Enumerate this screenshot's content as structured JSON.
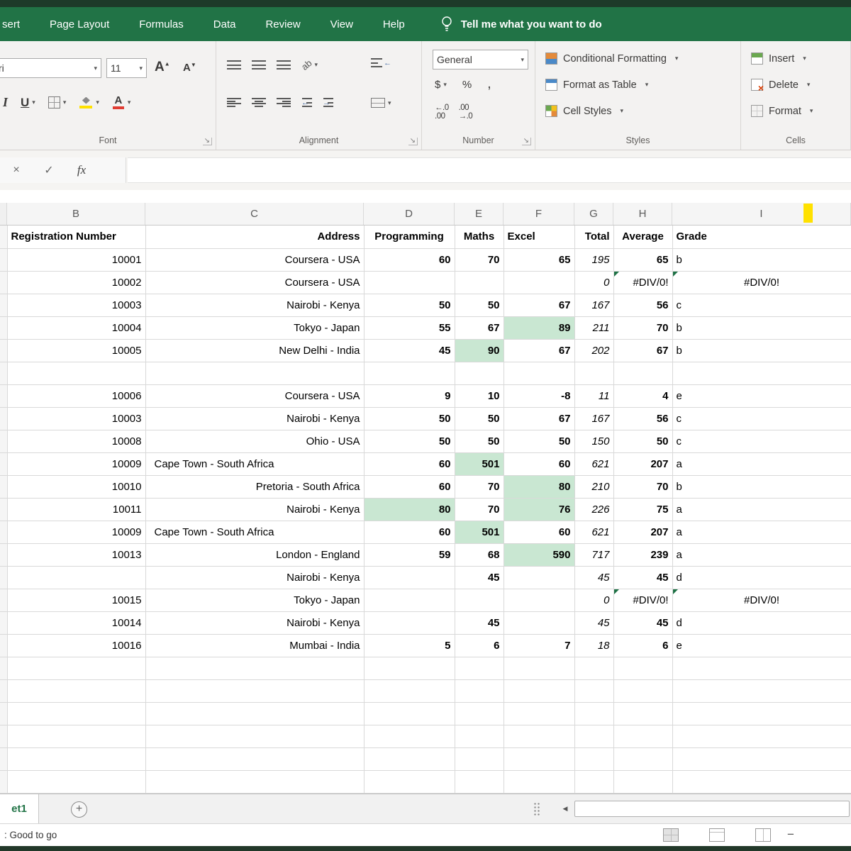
{
  "colors": {
    "excel_green": "#217346",
    "highlight_green": "#c9e7d2",
    "error_indicator_green": "#1e7145",
    "fill_color_yellow": "#ffe100",
    "font_color_red": "#e03c32",
    "delete_x_orange": "#d83b01"
  },
  "ribbon": {
    "tabs": [
      "sert",
      "Page Layout",
      "Formulas",
      "Data",
      "Review",
      "View",
      "Help"
    ],
    "tell_me": "Tell me what you want to do",
    "groups": {
      "font": {
        "label": "Font",
        "font_name": "ri",
        "font_size": "11"
      },
      "alignment": {
        "label": "Alignment"
      },
      "number": {
        "label": "Number",
        "format": "General",
        "currency": "$",
        "percent": "%",
        "comma": ","
      },
      "styles": {
        "label": "Styles",
        "items": [
          "Conditional Formatting",
          "Format as Table",
          "Cell Styles"
        ]
      },
      "cells": {
        "label": "Cells",
        "items": [
          "Insert",
          "Delete",
          "Format"
        ]
      }
    }
  },
  "formula_bar": {
    "fx_label": "fx",
    "value": ""
  },
  "sheet": {
    "columns": [
      "B",
      "C",
      "D",
      "E",
      "F",
      "G",
      "H",
      "I"
    ],
    "headers": [
      "Registration Number",
      "Address",
      "Programming",
      "Maths",
      "Excel",
      "Total",
      "Average",
      "Grade"
    ],
    "rows": [
      {
        "reg": "10001",
        "addr": "Coursera - USA",
        "d": "60",
        "e": "70",
        "f": "65",
        "total": "195",
        "avg": "65",
        "grade": "b",
        "hl": [],
        "err": false
      },
      {
        "reg": "10002",
        "addr": "Coursera - USA",
        "d": "",
        "e": "",
        "f": "",
        "total": "0",
        "avg": "#DIV/0!",
        "grade": "#DIV/0!",
        "hl": [],
        "err": true
      },
      {
        "reg": "10003",
        "addr": "Nairobi - Kenya",
        "d": "50",
        "e": "50",
        "f": "67",
        "total": "167",
        "avg": "56",
        "grade": "c",
        "hl": [],
        "err": false
      },
      {
        "reg": "10004",
        "addr": "Tokyo - Japan",
        "d": "55",
        "e": "67",
        "f": "89",
        "total": "211",
        "avg": "70",
        "grade": "b",
        "hl": [
          "f"
        ],
        "err": false
      },
      {
        "reg": "10005",
        "addr": "New Delhi - India",
        "d": "45",
        "e": "90",
        "f": "67",
        "total": "202",
        "avg": "67",
        "grade": "b",
        "hl": [
          "e"
        ],
        "err": false
      },
      {
        "reg": "",
        "addr": "",
        "d": "",
        "e": "",
        "f": "",
        "total": "",
        "avg": "",
        "grade": "",
        "hl": [],
        "err": false
      },
      {
        "reg": "10006",
        "addr": "Coursera - USA",
        "d": "9",
        "e": "10",
        "f": "-8",
        "total": "11",
        "avg": "4",
        "grade": "e",
        "hl": [],
        "err": false
      },
      {
        "reg": "10003",
        "addr": "Nairobi - Kenya",
        "d": "50",
        "e": "50",
        "f": "67",
        "total": "167",
        "avg": "56",
        "grade": "c",
        "hl": [],
        "err": false
      },
      {
        "reg": "10008",
        "addr": "Ohio - USA",
        "d": "50",
        "e": "50",
        "f": "50",
        "total": "150",
        "avg": "50",
        "grade": "c",
        "hl": [],
        "err": false
      },
      {
        "reg": "10009",
        "addr": "Cape Town - South Africa",
        "d": "60",
        "e": "501",
        "f": "60",
        "total": "621",
        "avg": "207",
        "grade": "a",
        "hl": [
          "e"
        ],
        "err": false,
        "addr_left": true
      },
      {
        "reg": "10010",
        "addr": "Pretoria - South Africa",
        "d": "60",
        "e": "70",
        "f": "80",
        "total": "210",
        "avg": "70",
        "grade": "b",
        "hl": [
          "f"
        ],
        "err": false
      },
      {
        "reg": "10011",
        "addr": "Nairobi - Kenya",
        "d": "80",
        "e": "70",
        "f": "76",
        "total": "226",
        "avg": "75",
        "grade": "a",
        "hl": [
          "d",
          "f"
        ],
        "err": false
      },
      {
        "reg": "10009",
        "addr": "Cape Town - South Africa",
        "d": "60",
        "e": "501",
        "f": "60",
        "total": "621",
        "avg": "207",
        "grade": "a",
        "hl": [
          "e"
        ],
        "err": false,
        "addr_left": true
      },
      {
        "reg": "10013",
        "addr": "London - England",
        "d": "59",
        "e": "68",
        "f": "590",
        "total": "717",
        "avg": "239",
        "grade": "a",
        "hl": [
          "f"
        ],
        "err": false
      },
      {
        "reg": "",
        "addr": "Nairobi - Kenya",
        "d": "",
        "e": "45",
        "f": "",
        "total": "45",
        "avg": "45",
        "grade": "d",
        "hl": [],
        "err": false
      },
      {
        "reg": "10015",
        "addr": "Tokyo - Japan",
        "d": "",
        "e": "",
        "f": "",
        "total": "0",
        "avg": "#DIV/0!",
        "grade": "#DIV/0!",
        "hl": [],
        "err": true
      },
      {
        "reg": "10014",
        "addr": "Nairobi - Kenya",
        "d": "",
        "e": "45",
        "f": "",
        "total": "45",
        "avg": "45",
        "grade": "d",
        "hl": [],
        "err": false
      },
      {
        "reg": "10016",
        "addr": "Mumbai - India",
        "d": "5",
        "e": "6",
        "f": "7",
        "total": "18",
        "avg": "6",
        "grade": "e",
        "hl": [],
        "err": false
      }
    ],
    "empty_row_count": 6
  },
  "sheet_tabs": {
    "active": "et1"
  },
  "status_bar": {
    "text": ": Good to go"
  }
}
